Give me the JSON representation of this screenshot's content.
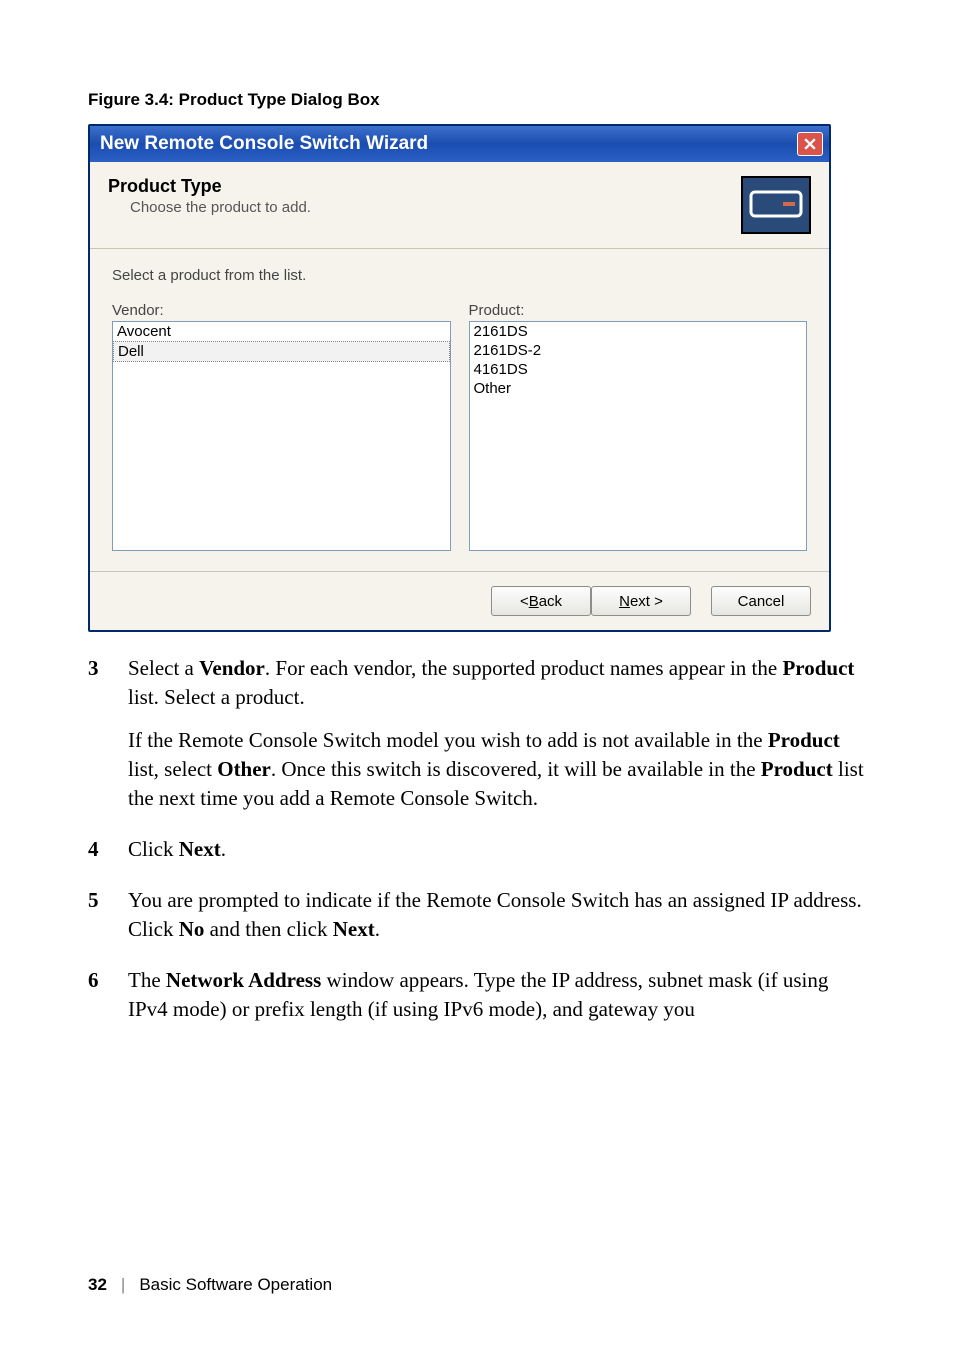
{
  "figure_caption": "Figure 3.4: Product Type Dialog Box",
  "dialog": {
    "title": "New Remote Console Switch Wizard",
    "header_title": "Product Type",
    "header_sub": "Choose the product to add.",
    "instruction": "Select a product from the list.",
    "vendor_label": "Vendor:",
    "product_label": "Product:",
    "vendors": [
      "Avocent",
      "Dell"
    ],
    "vendor_selected": "Dell",
    "products": [
      "2161DS",
      "2161DS-2",
      "4161DS",
      "Other"
    ],
    "buttons": {
      "back_prefix": "< ",
      "back_u": "B",
      "back_suffix": "ack",
      "next_u": "N",
      "next_suffix": "ext >",
      "cancel": "Cancel"
    }
  },
  "steps": [
    {
      "n": "3",
      "parts": [
        "Select a ",
        "Vendor",
        ". For each vendor, the supported product names appear in the ",
        "Product",
        " list. Select a product."
      ],
      "sub_parts": [
        "If the Remote Console Switch model you wish to add is not available in the ",
        "Product",
        " list, select ",
        "Other",
        ". Once this switch is discovered, it will be available in the ",
        "Product",
        " list the next time you add a Remote Console Switch."
      ]
    },
    {
      "n": "4",
      "parts": [
        "Click ",
        "Next",
        "."
      ]
    },
    {
      "n": "5",
      "parts": [
        "You are prompted to indicate if the Remote Console Switch has an assigned IP address. Click ",
        "No",
        " and then click ",
        "Next",
        "."
      ]
    },
    {
      "n": "6",
      "parts": [
        "The ",
        "Network Address",
        " window appears. Type the IP address, subnet mask (if using IPv4 mode) or prefix length (if using IPv6 mode), and gateway you"
      ]
    }
  ],
  "footer": {
    "page": "32",
    "section": "Basic Software Operation"
  }
}
